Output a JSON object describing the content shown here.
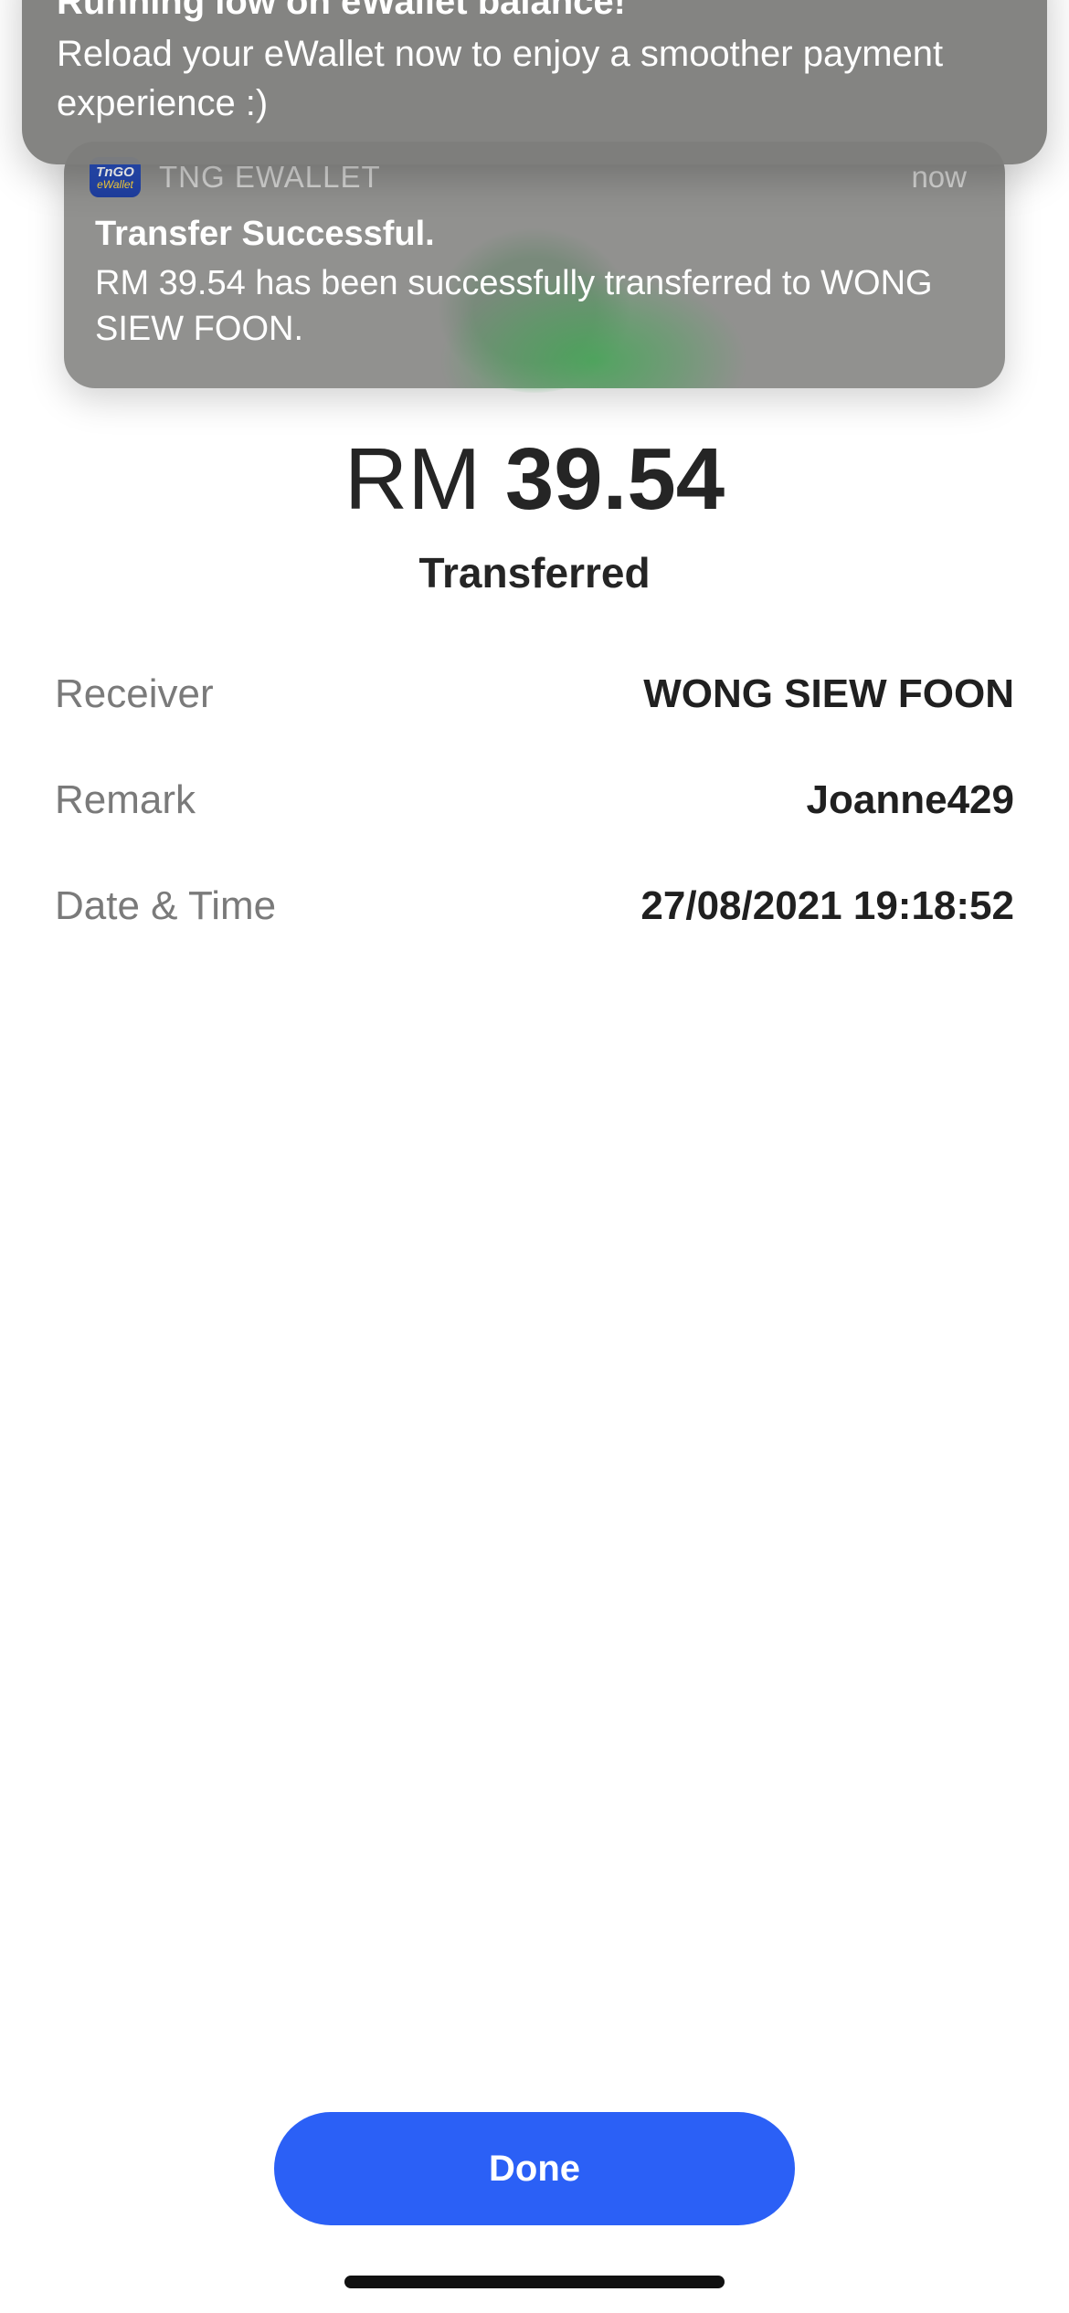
{
  "notifications": {
    "front": {
      "title": "Running low on eWallet balance!",
      "body": "Reload your eWallet now to enjoy a smoother payment experience :)"
    },
    "back": {
      "app_icon_top": "TnGO",
      "app_icon_bottom": "eWallet",
      "app_name": "TNG EWALLET",
      "time": "now",
      "title": "Transfer Successful.",
      "body": "RM 39.54 has been successfully transferred to WONG SIEW FOON."
    }
  },
  "result": {
    "currency": "RM",
    "amount": "39.54",
    "status": "Transferred"
  },
  "details": {
    "receiver": {
      "label": "Receiver",
      "value": "WONG SIEW FOON"
    },
    "remark": {
      "label": "Remark",
      "value": "Joanne429"
    },
    "datetime": {
      "label": "Date & Time",
      "value": "27/08/2021 19:18:52"
    }
  },
  "actions": {
    "done_label": "Done"
  },
  "colors": {
    "accent": "#2b60f6",
    "success": "#39c75a",
    "text_primary": "#252525",
    "text_secondary": "#7a7a7a"
  }
}
